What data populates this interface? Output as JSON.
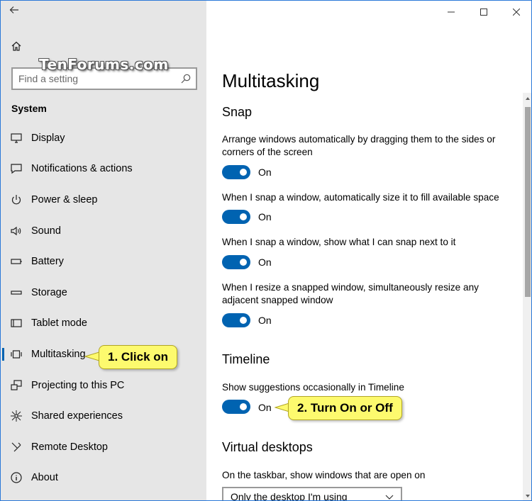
{
  "watermark": "TenForums.com",
  "sidebar": {
    "search_placeholder": "Find a setting",
    "section_title": "System",
    "items": [
      {
        "label": "Display",
        "icon": "monitor-icon"
      },
      {
        "label": "Notifications & actions",
        "icon": "notification-icon"
      },
      {
        "label": "Power & sleep",
        "icon": "power-icon"
      },
      {
        "label": "Sound",
        "icon": "speaker-icon"
      },
      {
        "label": "Battery",
        "icon": "battery-icon"
      },
      {
        "label": "Storage",
        "icon": "storage-icon"
      },
      {
        "label": "Tablet mode",
        "icon": "tablet-mode-icon"
      },
      {
        "label": "Multitasking",
        "icon": "multitasking-icon",
        "active": true
      },
      {
        "label": "Projecting to this PC",
        "icon": "projecting-icon"
      },
      {
        "label": "Shared experiences",
        "icon": "shared-icon"
      },
      {
        "label": "Remote Desktop",
        "icon": "remote-desktop-icon"
      },
      {
        "label": "About",
        "icon": "info-icon"
      }
    ]
  },
  "main": {
    "title": "Multitasking",
    "snap": {
      "heading": "Snap",
      "settings": [
        {
          "text": "Arrange windows automatically by dragging them to the sides or corners of the screen",
          "state": "On"
        },
        {
          "text": "When I snap a window, automatically size it to fill available space",
          "state": "On"
        },
        {
          "text": "When I snap a window, show what I can snap next to it",
          "state": "On"
        },
        {
          "text": "When I resize a snapped window, simultaneously resize any adjacent snapped window",
          "state": "On"
        }
      ]
    },
    "timeline": {
      "heading": "Timeline",
      "setting": {
        "text": "Show suggestions occasionally in Timeline",
        "state": "On"
      }
    },
    "virtual_desktops": {
      "heading": "Virtual desktops",
      "taskbar_label": "On the taskbar, show windows that are open on",
      "taskbar_value": "Only the desktop I'm using"
    }
  },
  "callouts": {
    "step1": "1. Click on",
    "step2": "2. Turn On or Off"
  },
  "colors": {
    "accent": "#0063b1",
    "sidebar_bg": "#e6e6e6",
    "callout_bg": "#fdfa6e",
    "window_border": "#2b79d8"
  }
}
